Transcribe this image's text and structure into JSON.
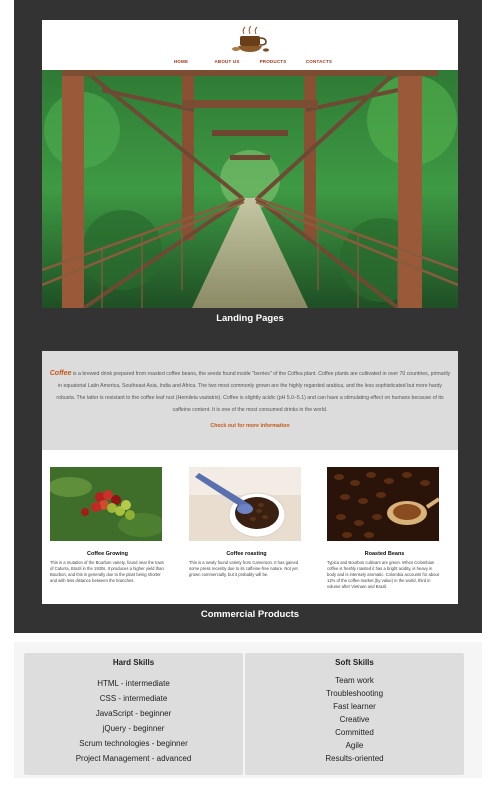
{
  "site": {
    "nav": [
      "HOME",
      "ABOUT US",
      "PRODUCTS",
      "CONTACTS"
    ]
  },
  "captions": {
    "landing": "Landing Pages",
    "commercial": "Commercial Products"
  },
  "intro": {
    "brand": "Coffee",
    "text": " is a brewed drink prepared from roasted coffee beans, the seeds found inside \"berries\" of the Coffea plant. Coffee plants are cultivated in over 70 countries, primarily in equatorial Latin America, Southeast Asia, India and Africa. The two most commonly grown are the highly regarded arabica, and the less sophisticated but more hardy robusta. The latter is resistant to the coffee leaf rust (Hemileia vastatrix). Coffee is slightly acidic (pH 5.0–5.1) and can have a stimulating effect on humans because of its caffeine content. It is one of the most consumed drinks in the world.",
    "link": "Check out for more information"
  },
  "products": [
    {
      "title": "Coffee Growing",
      "desc": "This is a mutation of the Bourbon variety, found near the town of Caturra, Brazil in the 1930s. It produces a higher yield than Bourbon, and this is generally due to the plant being shorter and with less distance between the branches."
    },
    {
      "title": "Coffee roasting",
      "desc": "This is a newly found variety from Cameroon. It has gained some press recently due to its caffeine-free nature. Not yet grown commercially, but it probably will be."
    },
    {
      "title": "Roasted Beans",
      "desc": "Typica and Bourbon cultivars are green. When Colombian coffee is freshly roasted it has a bright acidity, is heavy in body and is intensely aromatic. Colombia accounts for about 12% of the coffee market (by value) in the world, third in volume after Vietnam and Brazil."
    }
  ],
  "skills": {
    "hard_title": "Hard Skills",
    "hard": [
      "HTML - intermediate",
      "CSS - intermediate",
      "JavaScript - beginner",
      "jQuery - beginner",
      "Scrum technologies - beginner",
      "Project Management - advanced"
    ],
    "soft_title": "Soft Skills",
    "soft": [
      "Team work",
      "Troubleshooting",
      "Fast learner",
      "Creative",
      "Committed",
      "Agile",
      "Results-oriented"
    ]
  },
  "colors": {
    "frame": "#333333",
    "accent": "#c25a1c",
    "nav": "#a0341a",
    "card": "#dddddd"
  }
}
